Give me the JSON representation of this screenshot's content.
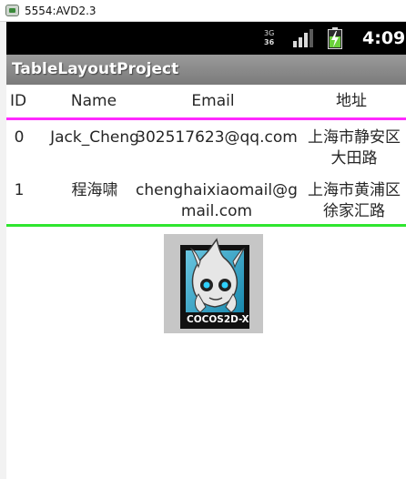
{
  "window": {
    "title": "5554:AVD2.3"
  },
  "status_bar": {
    "network_icon_top": "3G",
    "network_icon_bottom": "36",
    "time": "4:09",
    "network": "network-3g-icon",
    "signal": "signal-icon",
    "battery": "battery-charging-icon",
    "battery_color": "#6bd13a"
  },
  "app": {
    "title": "TableLayoutProject"
  },
  "table": {
    "headers": [
      "ID",
      "Name",
      "Email",
      "地址"
    ],
    "rows": [
      {
        "id": "0",
        "name": "Jack_Cheng",
        "email": "302517623@qq.com",
        "address": "上海市静安区大田路"
      },
      {
        "id": "1",
        "name": "程海啸",
        "email": "chenghaixiaomail@gmail.com",
        "address": "上海市黄浦区徐家汇路"
      }
    ],
    "header_divider_color": "#ff2aff",
    "footer_divider_color": "#2fe62f"
  },
  "logo": {
    "icon": "cocos2d-x-logo-icon",
    "text": "COCOS2D-X"
  }
}
